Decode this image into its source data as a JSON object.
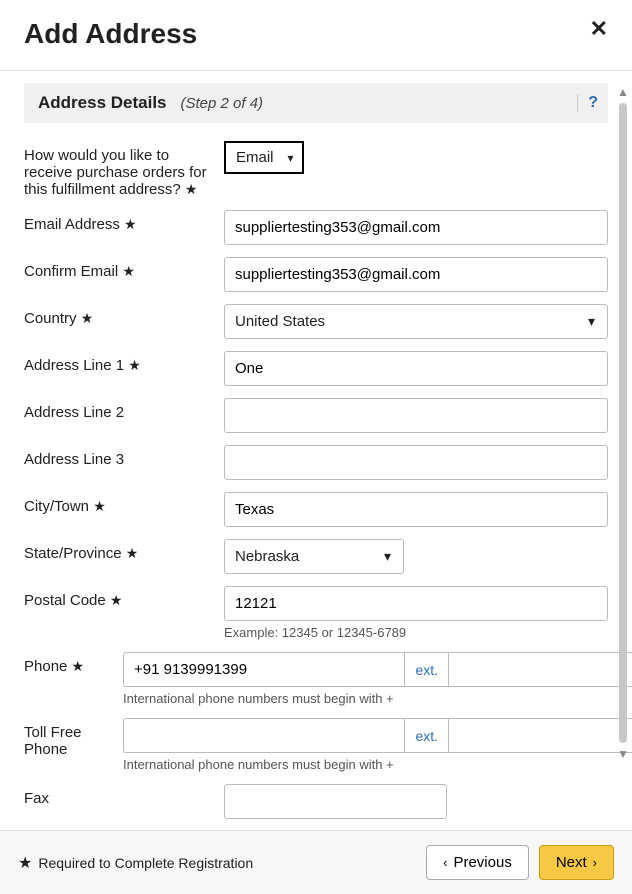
{
  "header": {
    "title": "Add Address"
  },
  "section": {
    "title": "Address Details",
    "step": "(Step 2 of 4)",
    "help": "?"
  },
  "labels": {
    "receive_method": "How would you like to receive purchase orders for this fulfillment address?",
    "email": "Email Address",
    "confirm_email": "Confirm Email",
    "country": "Country",
    "addr1": "Address Line 1",
    "addr2": "Address Line 2",
    "addr3": "Address Line 3",
    "city": "City/Town",
    "state": "State/Province",
    "postal": "Postal Code",
    "phone": "Phone",
    "tollfree": "Toll Free Phone",
    "fax": "Fax",
    "ext": "ext."
  },
  "values": {
    "receive_method": "Email",
    "email": "suppliertesting353@gmail.com",
    "confirm_email": "suppliertesting353@gmail.com",
    "country": "United States",
    "addr1": "One",
    "addr2": "",
    "addr3": "",
    "city": "Texas",
    "state": "Nebraska",
    "postal": "12121",
    "phone": "+91 9139991399",
    "phone_ext": "",
    "tollfree": "",
    "tollfree_ext": "",
    "fax": ""
  },
  "hints": {
    "postal_example": "Example: 12345 or 12345-6789",
    "intl_phone": "International phone numbers must begin with +"
  },
  "footer": {
    "required_note": "Required to Complete Registration",
    "previous": "Previous",
    "next": "Next"
  },
  "required_marker": "★"
}
